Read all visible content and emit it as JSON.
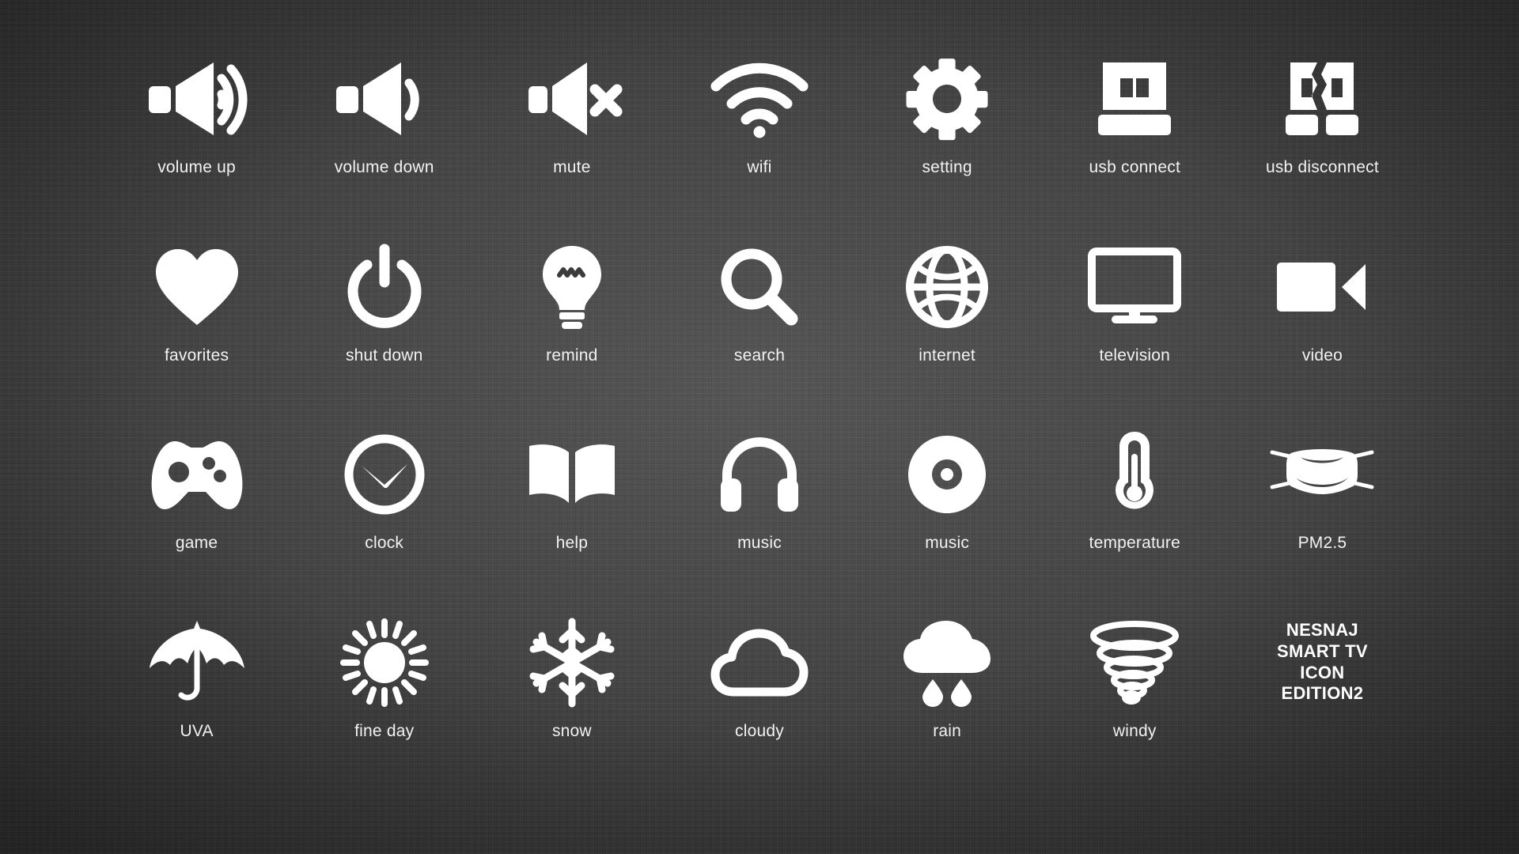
{
  "meta": {
    "background_color": "#3b3b3b",
    "icon_color": "#ffffff",
    "label_color": "#f2f2f2",
    "columns": 7,
    "rows": 4
  },
  "icons": [
    {
      "id": "volume-up",
      "label": "volume up"
    },
    {
      "id": "volume-down",
      "label": "volume down"
    },
    {
      "id": "mute",
      "label": "mute"
    },
    {
      "id": "wifi",
      "label": "wifi"
    },
    {
      "id": "setting",
      "label": "setting"
    },
    {
      "id": "usb-connect",
      "label": "usb connect"
    },
    {
      "id": "usb-disconnect",
      "label": "usb disconnect"
    },
    {
      "id": "favorites",
      "label": "favorites"
    },
    {
      "id": "shut-down",
      "label": "shut down"
    },
    {
      "id": "remind",
      "label": "remind"
    },
    {
      "id": "search",
      "label": "search"
    },
    {
      "id": "internet",
      "label": "internet"
    },
    {
      "id": "television",
      "label": "television"
    },
    {
      "id": "video",
      "label": "video"
    },
    {
      "id": "game",
      "label": "game"
    },
    {
      "id": "clock",
      "label": "clock"
    },
    {
      "id": "help",
      "label": "help"
    },
    {
      "id": "music-headphones",
      "label": "music"
    },
    {
      "id": "music-disc",
      "label": "music"
    },
    {
      "id": "temperature",
      "label": "temperature"
    },
    {
      "id": "pm25",
      "label": "PM2.5"
    },
    {
      "id": "uva",
      "label": "UVA"
    },
    {
      "id": "fine-day",
      "label": "fine day"
    },
    {
      "id": "snow",
      "label": "snow"
    },
    {
      "id": "cloudy",
      "label": "cloudy"
    },
    {
      "id": "rain",
      "label": "rain"
    },
    {
      "id": "windy",
      "label": "windy"
    }
  ],
  "branding": {
    "line1": "NESNAJ",
    "line2": "SMART TV",
    "line3": "ICON",
    "line4": "EDITION2"
  }
}
